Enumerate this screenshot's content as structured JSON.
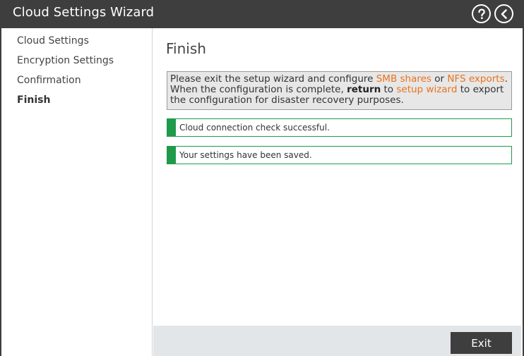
{
  "window": {
    "title": "Cloud Settings Wizard"
  },
  "header": {
    "help_icon": "help-circle-icon",
    "back_icon": "chevron-left-circle-icon"
  },
  "sidebar": {
    "items": [
      {
        "label": "Cloud Settings",
        "active": false
      },
      {
        "label": "Encryption Settings",
        "active": false
      },
      {
        "label": "Confirmation",
        "active": false
      },
      {
        "label": "Finish",
        "active": true
      }
    ]
  },
  "main": {
    "heading": "Finish",
    "info": {
      "part1": "Please exit the setup wizard and configure ",
      "link_smb": "SMB shares",
      "part2": " or ",
      "link_nfs": "NFS exports",
      "part3": ". When the configuration is complete, ",
      "bold_return": "return",
      "part4": " to ",
      "link_wizard": "setup wizard",
      "part5": " to export the configuration for disaster recovery purposes."
    },
    "status": [
      {
        "text": "Cloud connection check successful."
      },
      {
        "text": "Your settings have been saved."
      }
    ]
  },
  "footer": {
    "exit_label": "Exit"
  },
  "colors": {
    "titlebar": "#3e3e3e",
    "accent_link": "#e8731c",
    "success": "#1f9a4a",
    "footer_bg": "#e2e6e8"
  }
}
